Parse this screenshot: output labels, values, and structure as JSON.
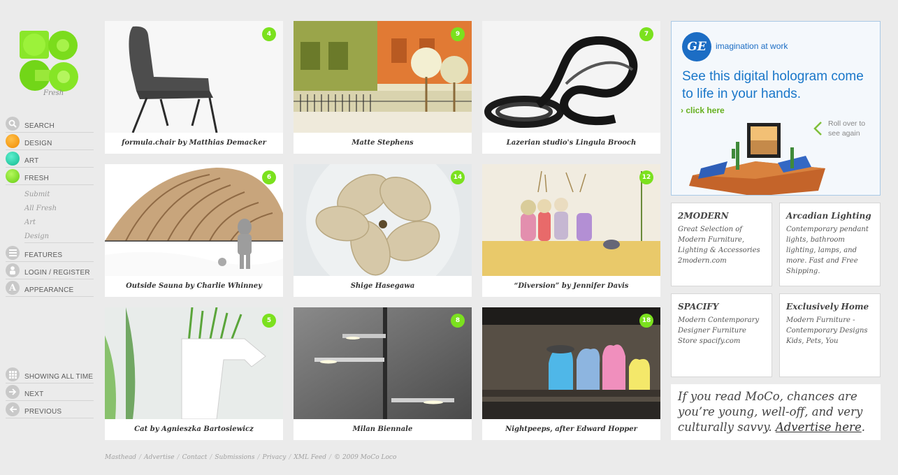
{
  "site": {
    "logo_name": "MoCo",
    "tagline": "Fresh"
  },
  "nav": {
    "items": [
      {
        "label": "SEARCH",
        "icon": "search-icon"
      },
      {
        "label": "DESIGN",
        "icon": "orange-dot-icon",
        "color": "#f39c12"
      },
      {
        "label": "ART",
        "icon": "teal-dot-icon",
        "color": "#1fcfa8"
      },
      {
        "label": "FRESH",
        "icon": "green-dot-icon",
        "color": "#7be11e"
      }
    ],
    "sub_items": [
      "Submit",
      "All Fresh",
      "Art",
      "Design"
    ],
    "items2": [
      {
        "label": "FEATURES",
        "icon": "features-icon"
      },
      {
        "label": "LOGIN / REGISTER",
        "icon": "user-icon"
      },
      {
        "label": "APPEARANCE",
        "icon": "appearance-icon",
        "glyph": "A"
      }
    ],
    "items3": [
      {
        "label": "SHOWING ALL TIME",
        "icon": "calendar-grid-icon"
      },
      {
        "label": "NEXT",
        "icon": "arrow-right-icon"
      },
      {
        "label": "PREVIOUS",
        "icon": "arrow-left-icon"
      }
    ]
  },
  "grid": [
    {
      "caption": "formula.chair by Matthias Demacker",
      "count": "4",
      "image": "gray-chair"
    },
    {
      "caption": "Matte Stephens",
      "count": "9",
      "image": "illustrated-street"
    },
    {
      "caption": "Lazerian studio's Lingula Brooch",
      "count": "7",
      "image": "black-loop-sculpture"
    },
    {
      "caption": "Outside Sauna by Charlie Whinney",
      "count": "6",
      "image": "wooden-sauna"
    },
    {
      "caption": "Shige Hasegawa",
      "count": "14",
      "image": "wooden-flower-stool"
    },
    {
      "caption": "“Diversion” by Jennifer Davis",
      "count": "12",
      "image": "painted-figures"
    },
    {
      "caption": "Cat by Agnieszka Bartosiewicz",
      "count": "5",
      "image": "grass-planter-cat"
    },
    {
      "caption": "Milan Biennale",
      "count": "8",
      "image": "shelf-lights"
    },
    {
      "caption": "Nightpeeps, after Edward Hopper",
      "count": "18",
      "image": "peeps-diorama"
    }
  ],
  "ge_ad": {
    "logo": "GE",
    "tagline": "imagination at work",
    "headline": "See this digital hologram come to life in your hands.",
    "click": "› click here",
    "roll": "Roll over to see again"
  },
  "text_ads": [
    {
      "title": "2MODERN",
      "body": "Great Selection of Modern Furniture, Lighting & Accessories 2modern.com"
    },
    {
      "title": "Arcadian Lighting",
      "body": "Contemporary pendant lights, bathroom lighting, lamps, and more. Fast and Free Shipping."
    },
    {
      "title": "SPACIFY",
      "body": "Modern Contemporary Designer Furniture Store spacify.com"
    },
    {
      "title": "Exclusively Home",
      "body": "Modern Furniture - Contemporary Designs Kids, Pets, You"
    }
  ],
  "moco_ad": {
    "text": "If you read MoCo, chances are you’re young, well-off, and very culturally savvy.",
    "link": "Advertise here",
    "end": "."
  },
  "footer": {
    "links": [
      "Masthead",
      "Advertise",
      "Contact",
      "Submissions",
      "Privacy",
      "XML Feed"
    ],
    "separator": "/",
    "copyright": "© 2009 MoCo Loco"
  }
}
